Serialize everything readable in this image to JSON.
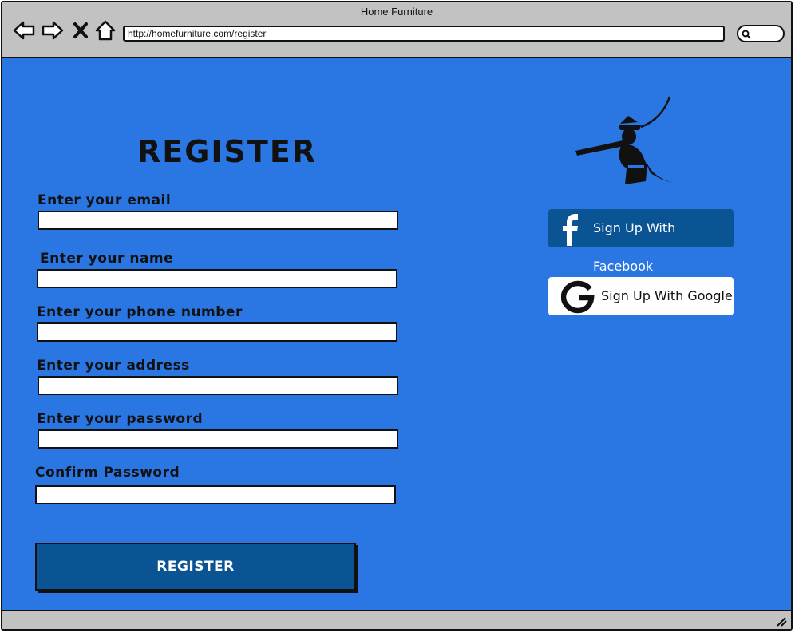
{
  "browser": {
    "window_title": "Home Furniture",
    "url": "http://homefurniture.com/register",
    "icons": [
      "back-icon",
      "forward-icon",
      "close-icon",
      "home-icon",
      "search-icon"
    ]
  },
  "page": {
    "title": "REGISTER",
    "background_color": "#2a76e3",
    "fields": [
      {
        "label": "Enter your email",
        "value": ""
      },
      {
        "label": "Enter your name",
        "value": ""
      },
      {
        "label": "Enter your phone number",
        "value": ""
      },
      {
        "label": "Enter your address",
        "value": ""
      },
      {
        "label": "Enter your password",
        "value": ""
      },
      {
        "label": "Confirm Password",
        "value": ""
      }
    ],
    "register_button": "REGISTER",
    "button_color": "#0a5494"
  },
  "social": {
    "facebook_label": "Sign Up With Facebook",
    "google_label": "Sign Up With Google"
  }
}
